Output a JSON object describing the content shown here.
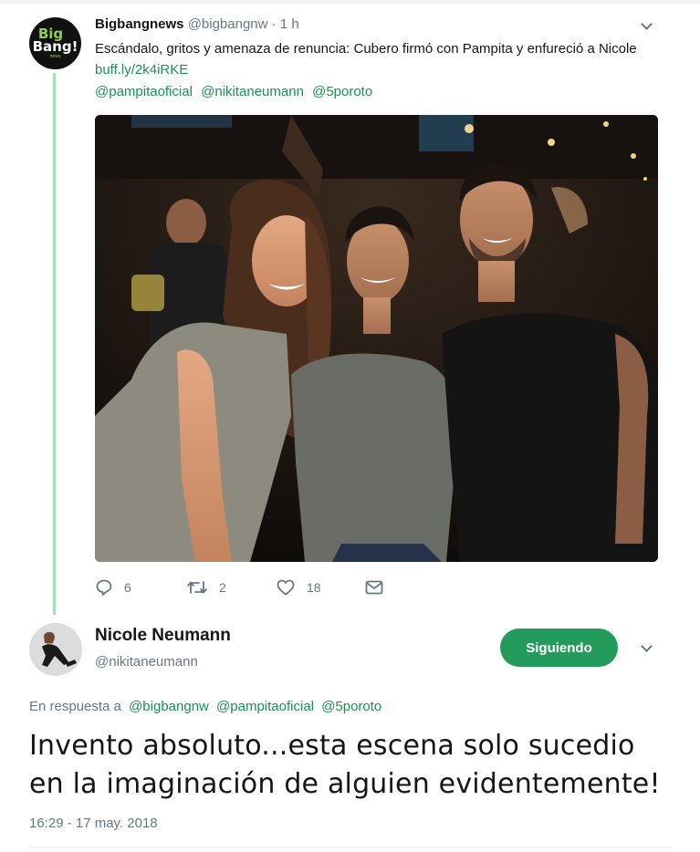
{
  "tweet": {
    "avatar": {
      "line1": "Big",
      "line2": "Bang!",
      "line3": "news"
    },
    "author_name": "Bigbangnews",
    "author_handle": "@bigbangnw",
    "separator": "·",
    "time": "1 h",
    "text": "Escándalo, gritos y amenaza de renuncia: Cubero firmó con Pampita y enfureció a Nicole",
    "link": "buff.ly/2k4iRKE",
    "mentions": [
      "@pampitaoficial",
      "@nikitaneumann",
      "@5poroto"
    ],
    "photo_alt": "photo",
    "actions": {
      "reply_count": "6",
      "retweet_count": "2",
      "like_count": "18"
    }
  },
  "reply": {
    "author_name": "Nicole Neumann",
    "author_handle": "@nikitaneumann",
    "follow_label": "Siguiendo",
    "in_reply_prefix": "En respuesta a",
    "in_reply_mentions": [
      "@bigbangnw",
      "@pampitaoficial",
      "@5poroto"
    ],
    "text_line1": "Invento absoluto...esta escena solo sucedio",
    "text_line2": "en la imaginación de alguien evidentemente!",
    "timestamp": "16:29 - 17 may. 2018"
  },
  "colors": {
    "accent_green": "#229b5b",
    "link_green": "#1b8f5a",
    "muted_text": "#657786",
    "thread_line": "#a5e0b8"
  },
  "icons": [
    "reply-icon",
    "retweet-icon",
    "like-icon",
    "direct-message-icon",
    "chevron-down-icon"
  ]
}
